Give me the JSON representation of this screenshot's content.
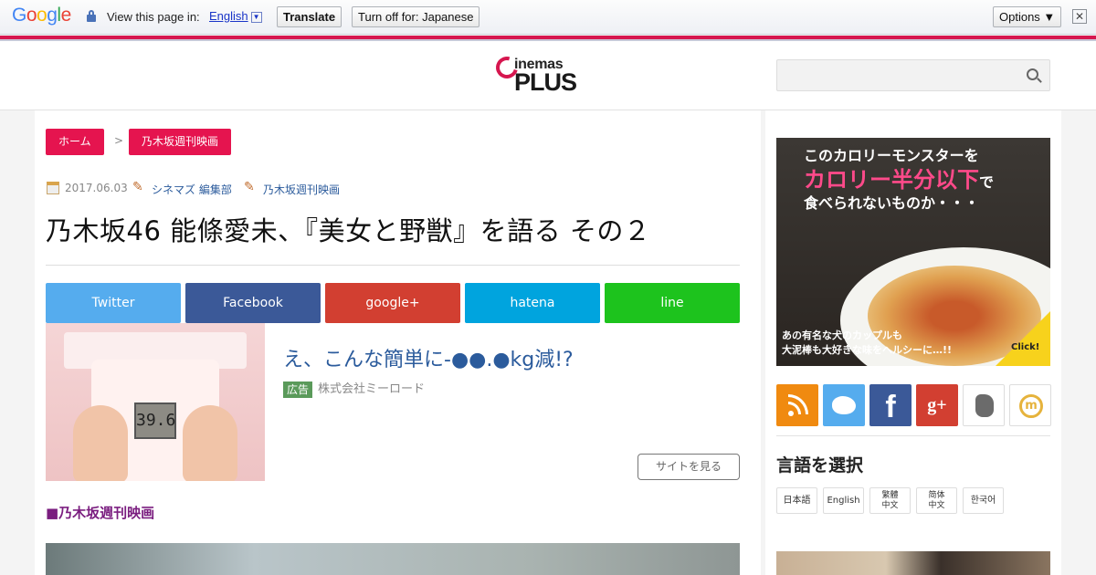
{
  "translate_bar": {
    "logo": "Google",
    "view_text": "View this page in:",
    "language": "English",
    "lang_arrow": "▼",
    "translate_label": "Translate",
    "turnoff_label": "Turn off for: Japanese",
    "options_label": "Options ▼",
    "close": "✕"
  },
  "header": {
    "brand_top": "inemas",
    "brand_bottom": "PLUS",
    "search_placeholder": ""
  },
  "breadcrumb": {
    "home": "ホーム",
    "sep": ">",
    "category": "乃木坂週刊映画"
  },
  "meta": {
    "date": "2017.06.03",
    "author": "シネマズ 編集部",
    "category": "乃木坂週刊映画"
  },
  "article": {
    "title": "乃木坂46 能條愛未、『美女と野獣』を語る その２",
    "section_heading": "■乃木坂週刊映画"
  },
  "share": {
    "twitter": "Twitter",
    "facebook": "Facebook",
    "google": "google+",
    "hatena": "hatena",
    "line": "line"
  },
  "ad": {
    "scale_reading": "39.6",
    "title": "え、こんな簡単に-●●.●kg減!?",
    "badge": "広告",
    "sponsor": "株式会社ミーロード",
    "button": "サイトを見る"
  },
  "sidebar": {
    "banner": {
      "line1": "このカロリーモンスターを",
      "line2": "カロリー半分以下",
      "line2_suffix": "で",
      "line3": "食べられないものか・・・",
      "line4": "あの有名な犬のカップルも",
      "line5": "大泥棒も大好きな味をヘルシーに…!!",
      "click": "Click!"
    },
    "social_icons": [
      "rss-icon",
      "twitter-icon",
      "facebook-icon",
      "google-plus-icon",
      "evernote-icon",
      "mixi-icon"
    ],
    "facebook_glyph": "f",
    "google_glyph": "g+",
    "mixi_glyph": "m",
    "language_heading": "言語を選択",
    "languages": [
      "日本語",
      "English",
      "繁體",
      "中文",
      "简体",
      "中文",
      "한국어"
    ]
  },
  "colors": {
    "accent": "#e5144f",
    "link": "#2b5b9c",
    "section": "#7a1d7f"
  }
}
